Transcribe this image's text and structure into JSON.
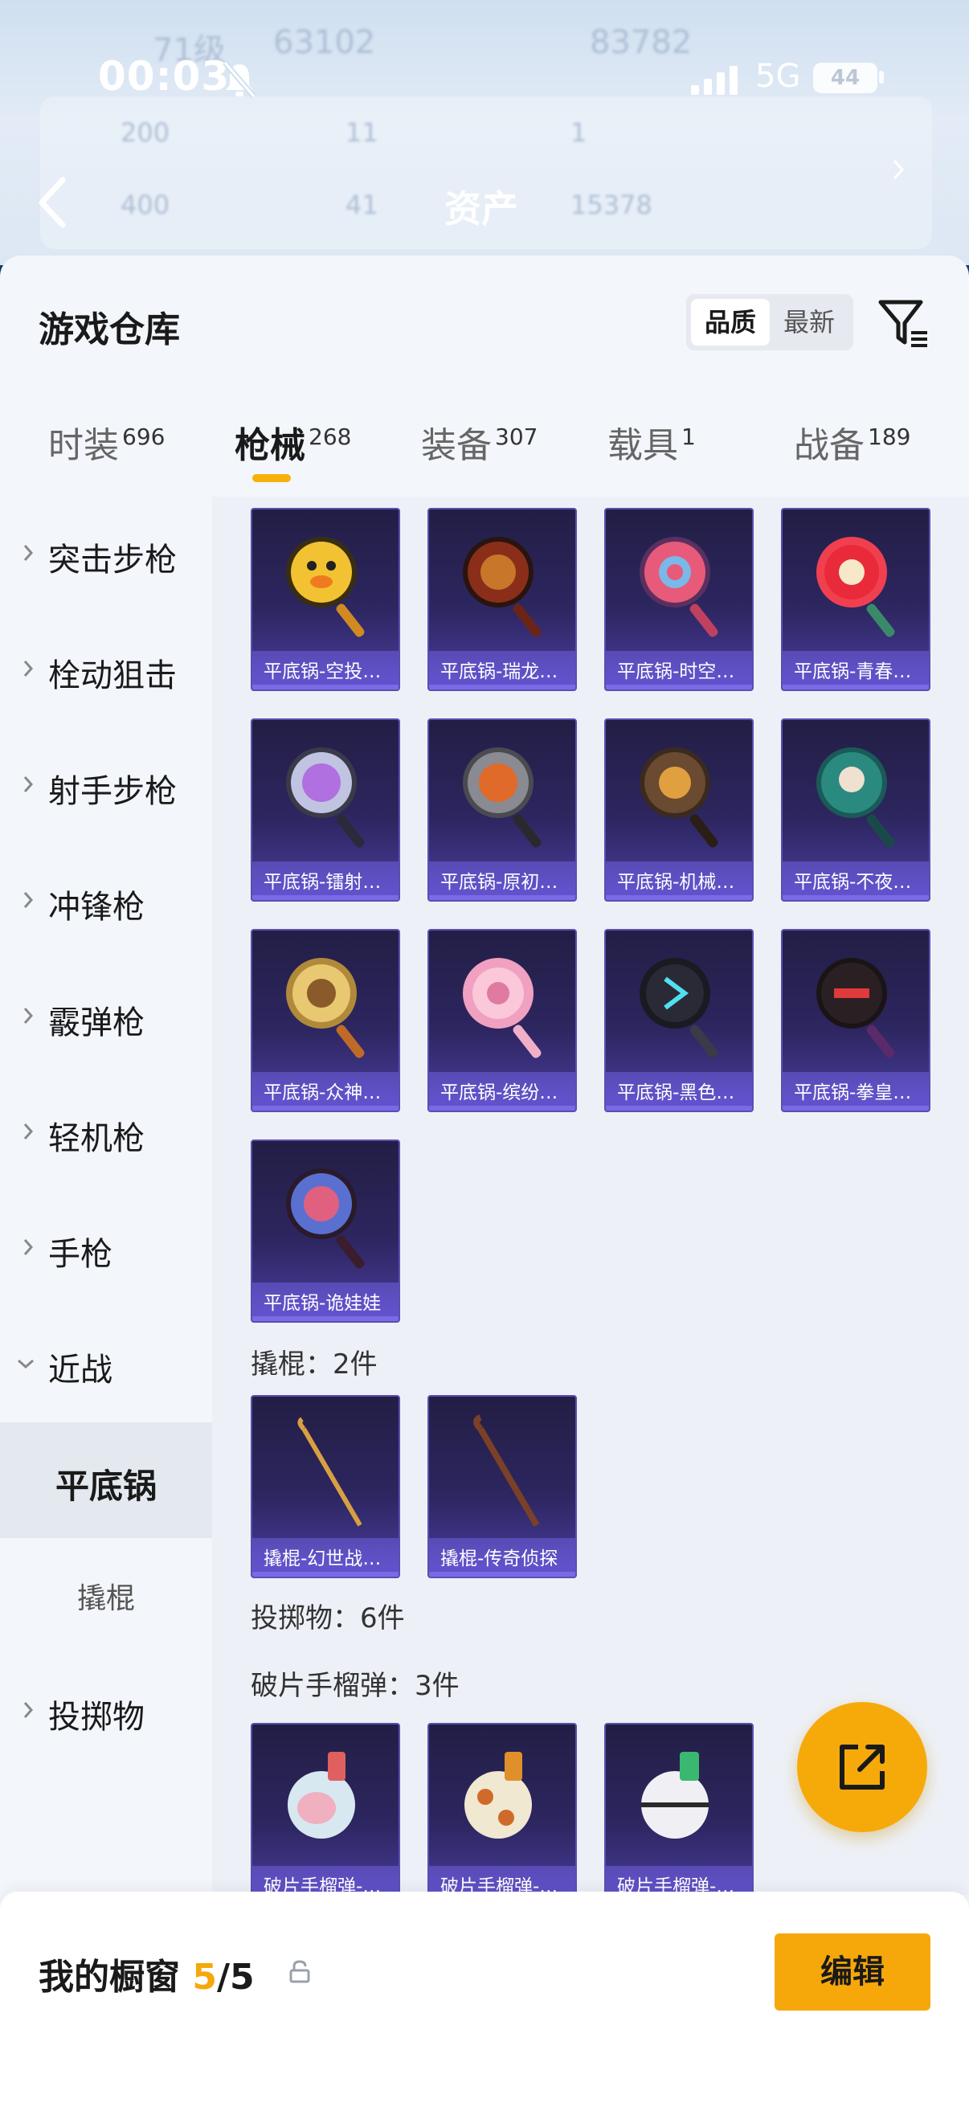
{
  "status_bar": {
    "time": "00:03",
    "network": "5G",
    "battery": "44"
  },
  "background": {
    "row1": [
      "71级",
      "63102",
      "83782"
    ],
    "row2": [
      "200",
      "11",
      "1"
    ],
    "row3": [
      "400",
      "41",
      "15378"
    ]
  },
  "header": {
    "title": "资产"
  },
  "warehouse": {
    "title": "游戏仓库",
    "sort": {
      "active": "品质",
      "inactive": "最新"
    }
  },
  "tabs": [
    {
      "label": "时装",
      "count": "696"
    },
    {
      "label": "枪械",
      "count": "268"
    },
    {
      "label": "装备",
      "count": "307"
    },
    {
      "label": "载具",
      "count": "1"
    },
    {
      "label": "战备",
      "count": "189"
    }
  ],
  "categories": [
    {
      "label": "突击步枪"
    },
    {
      "label": "栓动狙击"
    },
    {
      "label": "射手步枪"
    },
    {
      "label": "冲锋枪"
    },
    {
      "label": "霰弹枪"
    },
    {
      "label": "轻机枪"
    },
    {
      "label": "手枪"
    },
    {
      "label": "近战"
    },
    {
      "label": "平底锅"
    },
    {
      "label": "撬棍"
    },
    {
      "label": "投掷物"
    }
  ],
  "items": {
    "pans": [
      "平底锅-空投…",
      "平底锅-瑞龙…",
      "平底锅-时空…",
      "平底锅-青春…",
      "平底锅-镭射…",
      "平底锅-原初…",
      "平底锅-机械…",
      "平底锅-不夜…",
      "平底锅-众神…",
      "平底锅-缤纷…",
      "平底锅-黑色…",
      "平底锅-拳皇…",
      "平底锅-诡娃娃"
    ],
    "crowbar_header": "撬棍：2件",
    "crowbars": [
      "撬棍-幻世战…",
      "撬棍-传奇侦探"
    ],
    "throwable_header": "投掷物：6件",
    "grenade_header": "破片手榴弹：3件",
    "grenades": [
      "破片手榴弹-…",
      "破片手榴弹-…",
      "破片手榴弹-…"
    ]
  },
  "showcase": {
    "label": "我的橱窗",
    "current": "5",
    "total": "/5",
    "edit": "编辑"
  },
  "colors": {
    "accent": "#f6a80a",
    "card_bg": "#2d2660",
    "card_border": "#5a4fb0"
  }
}
